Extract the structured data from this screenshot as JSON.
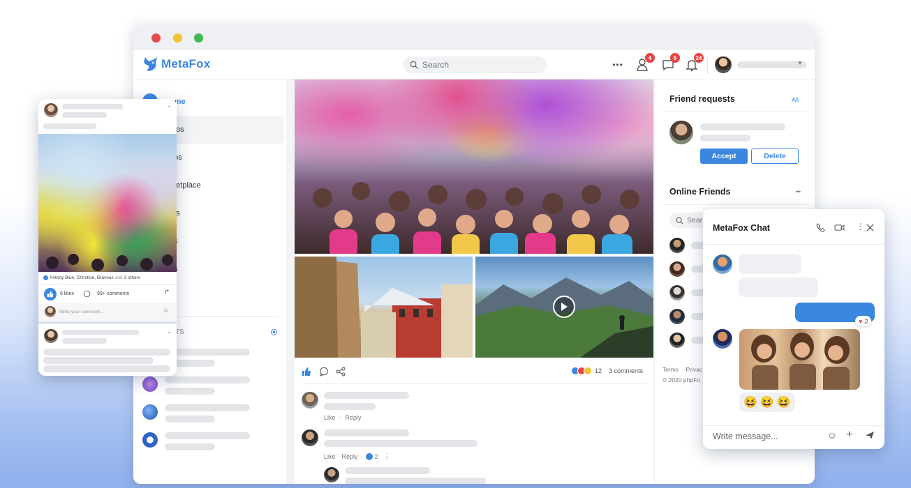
{
  "app": {
    "brand": "MetaFox",
    "accent": "#3b87e0"
  },
  "search": {
    "placeholder": "Search"
  },
  "topnav": {
    "badges": {
      "friends": "4",
      "messages": "6",
      "notifications": "24"
    },
    "more_glyph": "•••"
  },
  "sidebar": {
    "items": [
      {
        "label": "Home",
        "icon": "home-icon"
      },
      {
        "label": "Photos",
        "icon": "photo-icon"
      },
      {
        "label": "Videos",
        "icon": "video-icon"
      },
      {
        "label": "Marketplace",
        "icon": "store-icon"
      },
      {
        "label": "Events",
        "icon": "calendar-icon"
      },
      {
        "label": "Blogs",
        "icon": "blog-icon"
      },
      {
        "label": "Pages",
        "icon": "page-icon"
      },
      {
        "label": "More",
        "icon": "more-icon"
      }
    ],
    "visible": [
      "ome",
      "otos",
      "eos",
      "rketplace",
      "nts",
      "gs",
      "es",
      "re"
    ],
    "section_label": "TS"
  },
  "post": {
    "reaction_count": "12",
    "comments_count": "3 comments",
    "comments": [
      {
        "actions": [
          "Like",
          "Reply"
        ]
      },
      {
        "actions": [
          "Like",
          "Reply"
        ],
        "like_count": "2"
      }
    ]
  },
  "friend_requests": {
    "title": "Friend requests",
    "all_link": "All",
    "accept": "Accept",
    "delete": "Delete"
  },
  "online_friends": {
    "title": "Online Friends",
    "search_placeholder": "Search",
    "search_visible": "Sear",
    "more_glyph": "•••"
  },
  "footer": {
    "terms": "Terms",
    "privacy": "Privac",
    "copyright": "© 2020 phpFo"
  },
  "mobile_post": {
    "liked_by": "Antony Blue, Christine, Bravous",
    "liked_by_and": "and",
    "liked_by_others": "3 others",
    "likes": "6 likes",
    "comments": "99+ comments",
    "comment_placeholder": "Write your comment..."
  },
  "chat": {
    "title": "MetaFox Chat",
    "reaction_count": "2",
    "emoji_reactions": [
      "😆",
      "😆",
      "😆"
    ],
    "input_placeholder": "Write message..."
  },
  "colors": {
    "close": "#e5484d",
    "minimize": "#f2c12e",
    "maximize": "#3fb950",
    "badge": "#e64545",
    "button": "#3b87e0"
  }
}
